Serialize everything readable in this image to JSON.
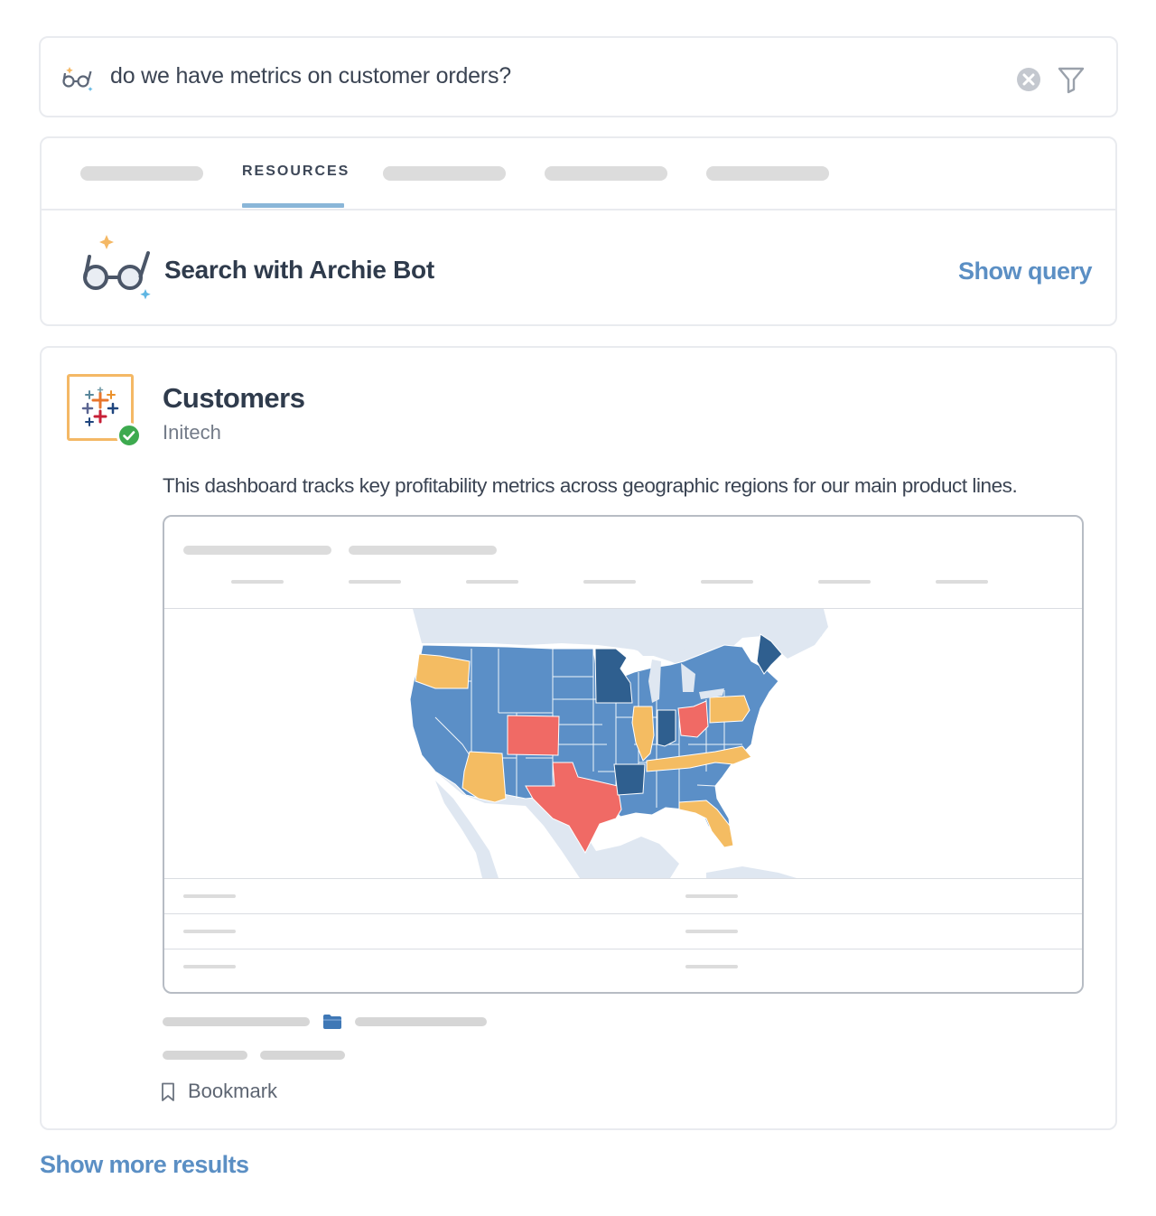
{
  "search": {
    "query": "do we have metrics on customer orders?"
  },
  "tabs": {
    "active_label": "RESOURCES"
  },
  "archie": {
    "title": "Search with Archie Bot",
    "show_query_label": "Show query"
  },
  "result": {
    "title": "Customers",
    "owner": "Initech",
    "description": "This dashboard tracks key profitability metrics across geographic regions for our main product lines."
  },
  "bookmark": {
    "label": "Bookmark"
  },
  "footer": {
    "show_more_label": "Show more results"
  },
  "colors": {
    "accent_link": "#5b8fc4",
    "map_blue": "#5b8fc7",
    "map_dark_blue": "#2f5f8f",
    "map_orange": "#f4bc62",
    "map_red": "#f06a65",
    "map_land": "#dfe7f1",
    "verified_green": "#3daa4f"
  },
  "icons": {
    "bot": "glasses-sparkle-icon",
    "clear": "close-circle-icon",
    "filter": "funnel-icon",
    "tableau": "tableau-logo-icon",
    "verified": "checkmark-icon",
    "folder": "folder-icon",
    "bookmark": "bookmark-icon"
  }
}
